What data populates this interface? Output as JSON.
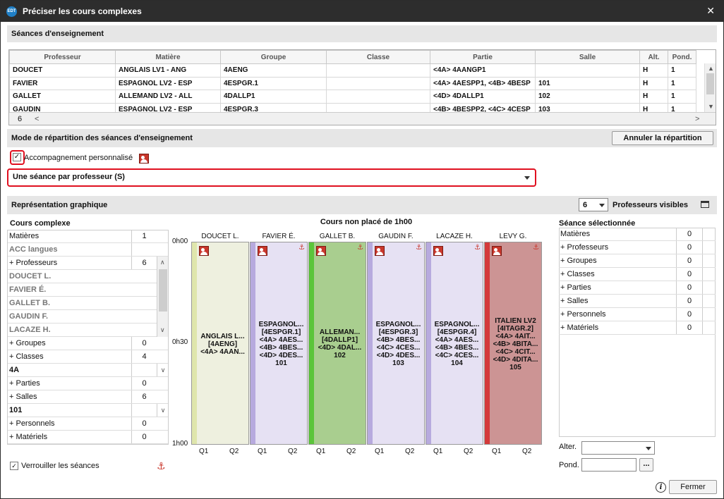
{
  "window": {
    "title": "Préciser les cours complexes",
    "app_icon": "EDT"
  },
  "seances": {
    "heading": "Séances d'enseignement",
    "columns": [
      "Professeur",
      "Matière",
      "Groupe",
      "Classe",
      "Partie",
      "Salle",
      "Alt.",
      "Pond."
    ],
    "rows": [
      [
        "DOUCET",
        "ANGLAIS LV1 - ANG",
        "4AENG",
        "",
        "<4A> 4AANGP1",
        "",
        "H",
        "1"
      ],
      [
        "FAVIER",
        "ESPAGNOL LV2 - ESP",
        "4ESPGR.1",
        "",
        "<4A> 4AESPP1, <4B> 4BESP",
        "101",
        "H",
        "1"
      ],
      [
        "GALLET",
        "ALLEMAND LV2 - ALL",
        "4DALLP1",
        "",
        "<4D> 4DALLP1",
        "102",
        "H",
        "1"
      ],
      [
        "GAUDIN",
        "ESPAGNOL LV2 - ESP",
        "4ESPGR.3",
        "",
        "<4B> 4BESPP2, <4C> 4CESP",
        "103",
        "H",
        "1"
      ]
    ],
    "count": "6"
  },
  "mode": {
    "heading": "Mode de répartition des séances d'enseignement",
    "cancel_label": "Annuler la répartition",
    "accomp_label": "Accompagnement personnalisé",
    "accomp_checked": true,
    "selected": "Une séance par professeur (S)"
  },
  "graph": {
    "heading": "Représentation graphique",
    "visible_count": "6",
    "visible_label": "Professeurs visibles"
  },
  "left": {
    "title": "Cours complexe",
    "rows": [
      {
        "label": "Matières",
        "value": "1"
      },
      {
        "label": "ACC langues",
        "value": "",
        "style": "grey"
      },
      {
        "label": "+ Professeurs",
        "value": "6"
      },
      {
        "label": "DOUCET L.",
        "style": "grey"
      },
      {
        "label": "FAVIER É.",
        "style": "grey"
      },
      {
        "label": "GALLET B.",
        "style": "grey"
      },
      {
        "label": "GAUDIN F.",
        "style": "grey"
      },
      {
        "label": "LACAZE H.",
        "style": "grey"
      },
      {
        "label": "+ Groupes",
        "value": "0"
      },
      {
        "label": "+ Classes",
        "value": "4"
      },
      {
        "label": "4A",
        "value": "",
        "style": "bold"
      },
      {
        "label": "+ Parties",
        "value": "0"
      },
      {
        "label": "+ Salles",
        "value": "6"
      },
      {
        "label": "101",
        "value": "",
        "style": "bold"
      },
      {
        "label": "+ Personnels",
        "value": "0"
      },
      {
        "label": "+ Matériels",
        "value": "0"
      }
    ],
    "lock_label": "Verrouiller les séances"
  },
  "chart": {
    "title": "Cours non placé de 1h00",
    "times": [
      "0h00",
      "0h30",
      "1h00"
    ],
    "quarters": [
      "Q1",
      "Q2"
    ],
    "teachers": [
      {
        "name": "DOUCET L.",
        "bg": "#eef0df",
        "strip": "#dfe6ac",
        "text": "ANGLAIS L...\n[4AENG]\n<4A> 4AAN..."
      },
      {
        "name": "FAVIER É.",
        "bg": "#e6e1f3",
        "strip": "#b7aade",
        "text": "ESPAGNOL...\n[4ESPGR.1]\n<4A> 4AES...\n<4B> 4BES...\n<4D> 4DES...\n101"
      },
      {
        "name": "GALLET B.",
        "bg": "#a9ce8f",
        "strip": "#5bc53a",
        "text": "ALLEMAN...\n[4DALLP1]\n<4D> 4DAL...\n102"
      },
      {
        "name": "GAUDIN F.",
        "bg": "#e6e1f3",
        "strip": "#b7aade",
        "text": "ESPAGNOL...\n[4ESPGR.3]\n<4B> 4BES...\n<4C> 4CES...\n<4D> 4DES...\n103"
      },
      {
        "name": "LACAZE H.",
        "bg": "#e6e1f3",
        "strip": "#b7aade",
        "text": "ESPAGNOL...\n[4ESPGR.4]\n<4A> 4AES...\n<4B> 4BES...\n<4C> 4CES...\n104"
      },
      {
        "name": "LEVY G.",
        "bg": "#cc9494",
        "strip": "#d43a3a",
        "text": "ITALIEN LV2\n[4ITAGR.2]\n<4A> 4AIT...\n<4B> 4BITA...\n<4C> 4CIT...\n<4D> 4DITA...\n105"
      }
    ]
  },
  "right": {
    "title": "Séance sélectionnée",
    "rows": [
      {
        "label": "Matières",
        "value": "0"
      },
      {
        "label": "+ Professeurs",
        "value": "0"
      },
      {
        "label": "+ Groupes",
        "value": "0"
      },
      {
        "label": "+ Classes",
        "value": "0"
      },
      {
        "label": "+ Parties",
        "value": "0"
      },
      {
        "label": "+ Salles",
        "value": "0"
      },
      {
        "label": "+ Personnels",
        "value": "0"
      },
      {
        "label": "+ Matériels",
        "value": "0"
      }
    ],
    "alter_label": "Alter.",
    "pond_label": "Pond.",
    "pond_btn": "...",
    "close_label": "Fermer"
  }
}
